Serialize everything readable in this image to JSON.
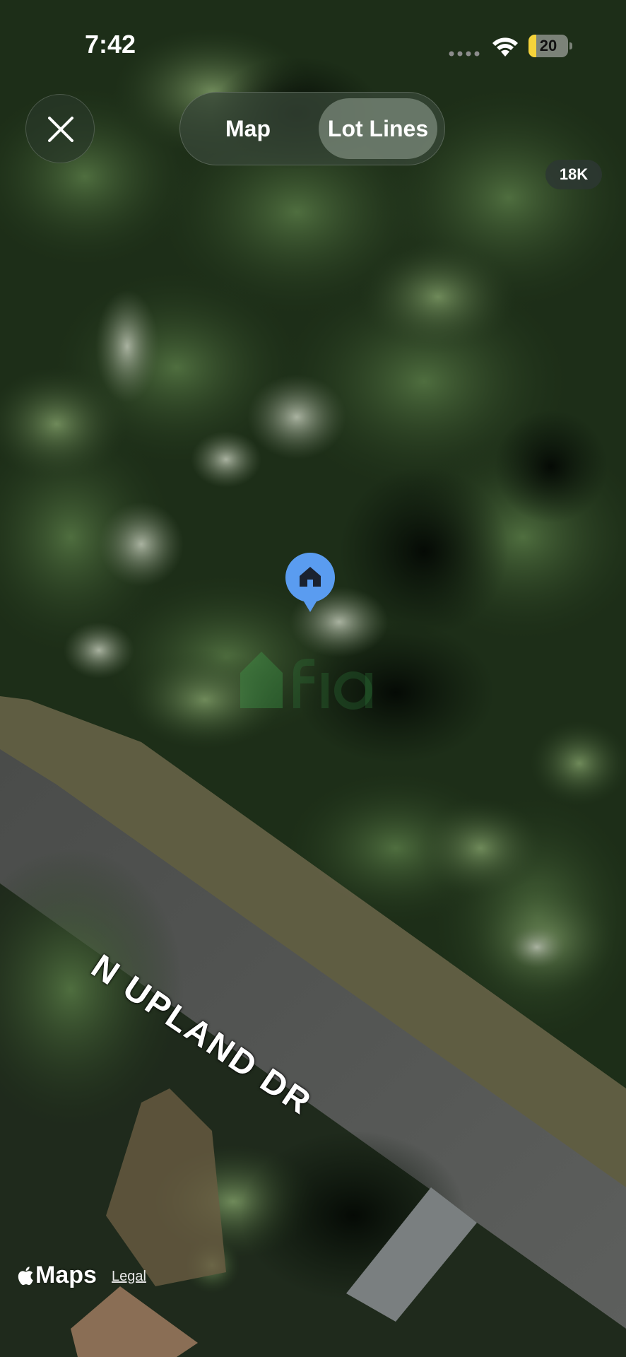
{
  "status_bar": {
    "time": "7:42",
    "battery_level": "20",
    "battery_fraction": 0.2
  },
  "toolbar": {
    "close_icon": "close-icon",
    "segments": [
      {
        "label": "Map",
        "selected": false
      },
      {
        "label": "Lot Lines",
        "selected": true
      }
    ]
  },
  "map": {
    "zoom_badge": "18K",
    "street_label": "N UPLAND DR",
    "pin_icon": "home-icon"
  },
  "attribution": {
    "brand": "Maps",
    "legal_link": "Legal"
  },
  "colors": {
    "pin": "#5a9cf0",
    "battery": "#f5d33a"
  }
}
